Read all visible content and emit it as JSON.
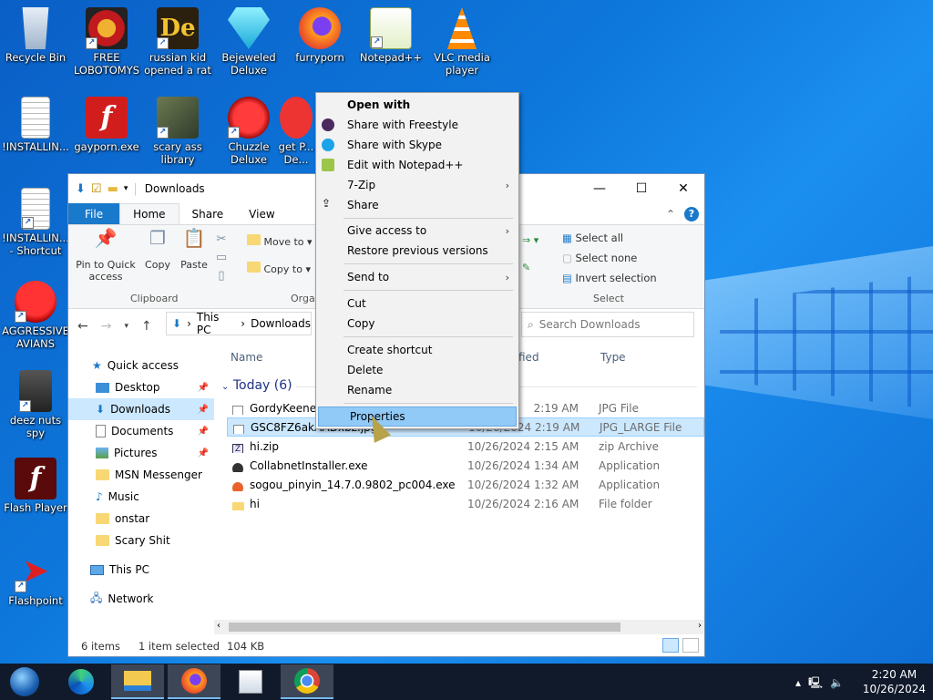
{
  "desktop": {
    "icons": [
      {
        "label": "Recycle Bin"
      },
      {
        "label": "FREE LOBOTOMYS"
      },
      {
        "label": "russian kid opened a rat"
      },
      {
        "label": "Bejeweled Deluxe"
      },
      {
        "label": "furryporn"
      },
      {
        "label": "Notepad++"
      },
      {
        "label": "VLC media player"
      },
      {
        "label": "!INSTALLIN..."
      },
      {
        "label": "gayporn.exe"
      },
      {
        "label": "scary ass library"
      },
      {
        "label": "Chuzzle Deluxe"
      },
      {
        "label": "get P... De..."
      },
      {
        "label": "!INSTALLIN... - Shortcut"
      },
      {
        "label": "AGGRESSIVE AVIANS"
      },
      {
        "label": "deez nuts spy"
      },
      {
        "label": "Flash Player"
      },
      {
        "label": "Flashpoint"
      }
    ]
  },
  "explorer": {
    "title": "Downloads",
    "tabs": {
      "file": "File",
      "home": "Home",
      "share": "Share",
      "view": "View"
    },
    "ribbon": {
      "pin": "Pin to Quick access",
      "copy": "Copy",
      "paste": "Paste",
      "move_to": "Move to",
      "copy_to": "Copy to",
      "clipboard": "Clipboard",
      "organize": "Orga",
      "select_all": "Select all",
      "select_none": "Select none",
      "invert_selection": "Invert selection",
      "select": "Select"
    },
    "address": {
      "this_pc": "This PC",
      "downloads": "Downloads"
    },
    "search_placeholder": "Search Downloads",
    "columns": {
      "name": "Name",
      "date": "fied",
      "type": "Type"
    },
    "group": "Today (6)",
    "nav": [
      {
        "label": "Quick access"
      },
      {
        "label": "Desktop"
      },
      {
        "label": "Downloads"
      },
      {
        "label": "Documents"
      },
      {
        "label": "Pictures"
      },
      {
        "label": "MSN Messenger"
      },
      {
        "label": "Music"
      },
      {
        "label": "onstar"
      },
      {
        "label": "Scary Shit"
      },
      {
        "label": "This PC"
      },
      {
        "label": "Network"
      }
    ],
    "files": [
      {
        "name": "GordyKeene.jp",
        "date": "2:19 AM",
        "type": "JPG File"
      },
      {
        "name": "GSC8FZ6akAADxbz.jpg_l",
        "date": "10/26/2024 2:19 AM",
        "type": "JPG_LARGE File"
      },
      {
        "name": "hi.zip",
        "date": "10/26/2024 2:15 AM",
        "type": "zip Archive"
      },
      {
        "name": "CollabnetInstaller.exe",
        "date": "10/26/2024 1:34 AM",
        "type": "Application"
      },
      {
        "name": "sogou_pinyin_14.7.0.9802_pc004.exe",
        "date": "10/26/2024 1:32 AM",
        "type": "Application"
      },
      {
        "name": "hi",
        "date": "10/26/2024 2:16 AM",
        "type": "File folder"
      }
    ],
    "status": {
      "items": "6 items",
      "selected": "1 item selected",
      "size": "104 KB"
    }
  },
  "context_menu": {
    "items": [
      {
        "label": "Open with"
      },
      {
        "label": "Share with Freestyle"
      },
      {
        "label": "Share with Skype"
      },
      {
        "label": "Edit with Notepad++"
      },
      {
        "label": "7-Zip"
      },
      {
        "label": "Share"
      },
      {
        "label": "Give access to"
      },
      {
        "label": "Restore previous versions"
      },
      {
        "label": "Send to"
      },
      {
        "label": "Cut"
      },
      {
        "label": "Copy"
      },
      {
        "label": "Create shortcut"
      },
      {
        "label": "Delete"
      },
      {
        "label": "Rename"
      },
      {
        "label": "Properties"
      }
    ]
  },
  "taskbar": {
    "time": "2:20 AM",
    "date": "10/26/2024"
  },
  "colors": {
    "accent": "#1979ca",
    "selection": "#cce8ff",
    "menu_highlight": "#91c9f7",
    "taskbar": "#101a2b"
  }
}
